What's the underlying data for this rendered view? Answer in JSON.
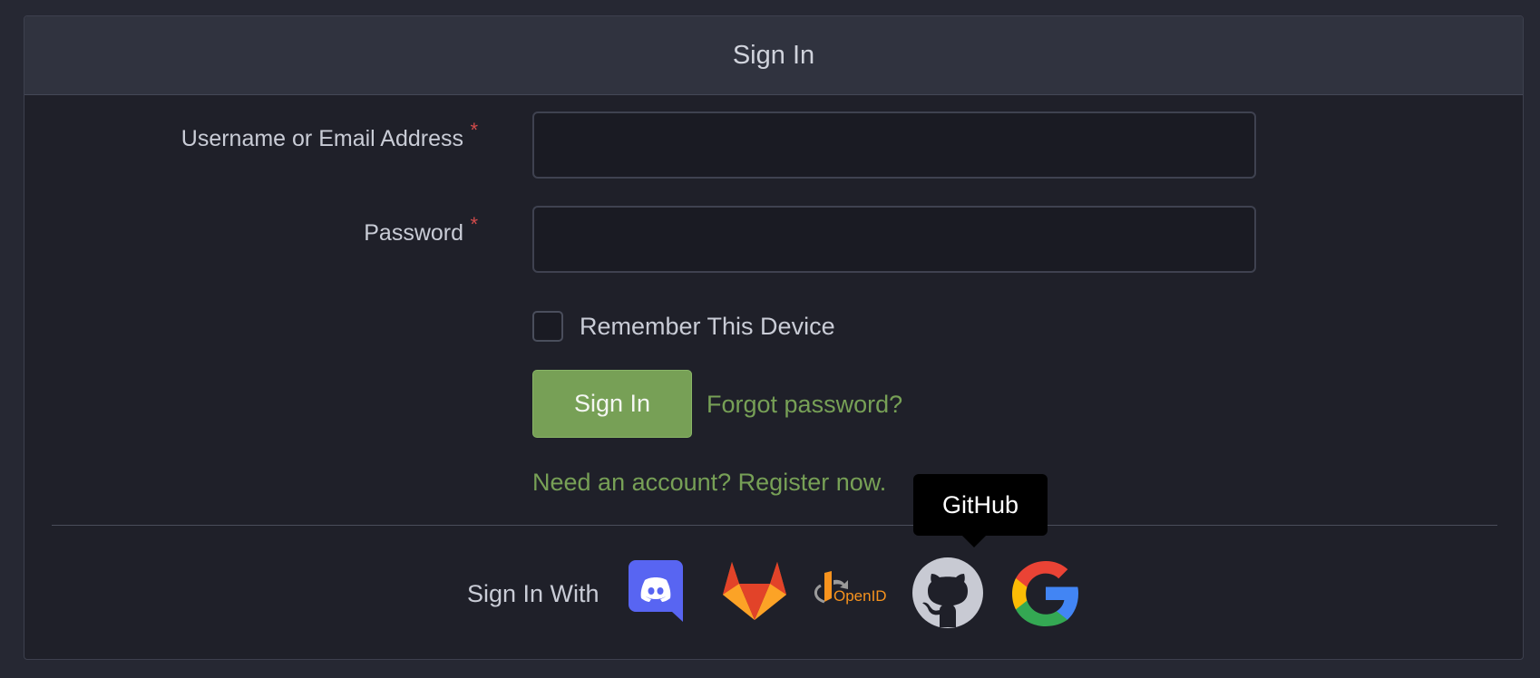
{
  "header": {
    "title": "Sign In"
  },
  "form": {
    "username_label": "Username or Email Address",
    "username_required": "*",
    "username_value": "",
    "password_label": "Password",
    "password_required": "*",
    "password_value": "",
    "remember_label": "Remember This Device",
    "remember_checked": false,
    "signin_button": "Sign In",
    "forgot_link": "Forgot password?",
    "register_link": "Need an account? Register now."
  },
  "social": {
    "label": "Sign In With",
    "providers": [
      {
        "name": "Discord",
        "icon": "discord-icon",
        "color": "#5865F2"
      },
      {
        "name": "GitLab",
        "icon": "gitlab-icon",
        "color": "#FC6D26"
      },
      {
        "name": "OpenID",
        "icon": "openid-icon",
        "color": "#F7931E"
      },
      {
        "name": "GitHub",
        "icon": "github-icon",
        "color": "#C8CAD3"
      },
      {
        "name": "Google",
        "icon": "google-icon",
        "color": "#4285F4"
      }
    ],
    "tooltip": "GitHub",
    "openid_text": "OpenID"
  },
  "colors": {
    "accent": "#77A056",
    "required": "#D24B4B",
    "background": "#262833",
    "panel": "#1F2029",
    "header": "#30333F"
  }
}
